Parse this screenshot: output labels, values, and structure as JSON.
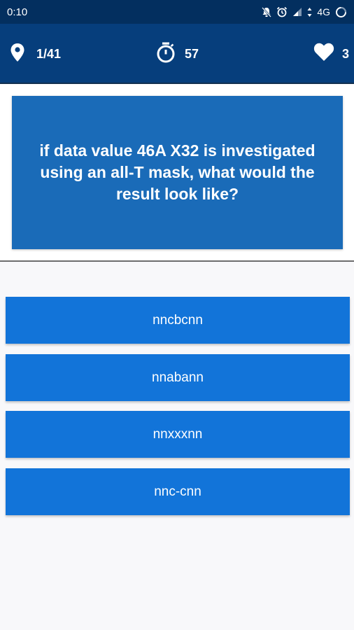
{
  "status_bar": {
    "time": "0:10",
    "network": "4G",
    "icons": [
      "muted-bell-icon",
      "alarm-clock-icon",
      "signal-icon",
      "data-arrows-icon",
      "loading-ring-icon"
    ]
  },
  "header": {
    "progress": "1/41",
    "progress_icon": "map-pin-icon",
    "timer": "57",
    "timer_icon": "stopwatch-icon",
    "lives": "3",
    "lives_icon": "heart-icon"
  },
  "question": {
    "text": "if data value 46A X32 is investigated using an all-T mask, what would the result look like?"
  },
  "answers": [
    {
      "label": "nncbcnn"
    },
    {
      "label": "nnabann"
    },
    {
      "label": "nnxxxnn"
    },
    {
      "label": "nnc-cnn"
    }
  ],
  "colors": {
    "status_bar": "#032f5f",
    "header": "#063e7c",
    "question_card": "#1a6bb8",
    "answer_button": "#1274d9",
    "background": "#f8f8fa"
  }
}
